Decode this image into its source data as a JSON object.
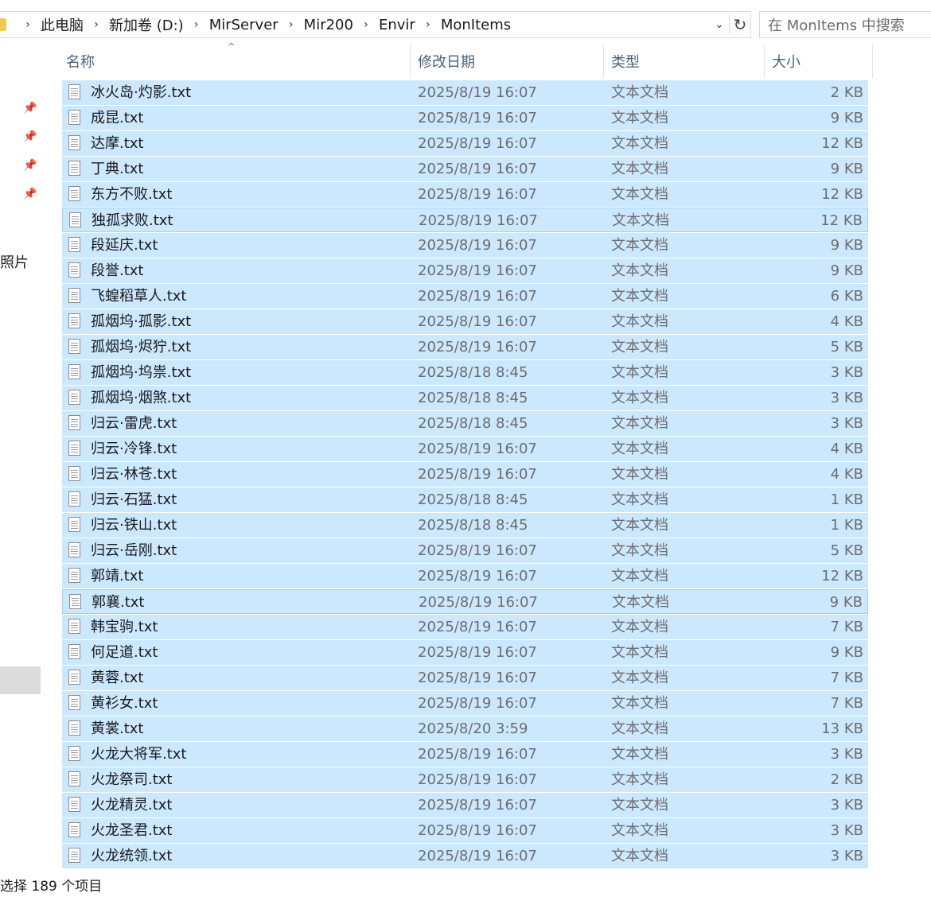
{
  "address": {
    "crumbs": [
      "此电脑",
      "新加卷 (D:)",
      "MirServer",
      "Mir200",
      "Envir",
      "MonItems"
    ],
    "separator": "›",
    "dropdown_glyph": "⌄",
    "refresh_glyph": "↻"
  },
  "search": {
    "placeholder": "在 MonItems 中搜索"
  },
  "nav": {
    "visible_label": "照片",
    "pin_icon": "pin-icon"
  },
  "columns": {
    "name": "名称",
    "date": "修改日期",
    "type": "类型",
    "size": "大小",
    "sort_glyph": "^"
  },
  "files": [
    {
      "name": "冰火岛·灼影.txt",
      "date": "2025/8/19 16:07",
      "type": "文本文档",
      "size": "2 KB"
    },
    {
      "name": "成昆.txt",
      "date": "2025/8/19 16:07",
      "type": "文本文档",
      "size": "9 KB"
    },
    {
      "name": "达摩.txt",
      "date": "2025/8/19 16:07",
      "type": "文本文档",
      "size": "12 KB"
    },
    {
      "name": "丁典.txt",
      "date": "2025/8/19 16:07",
      "type": "文本文档",
      "size": "9 KB"
    },
    {
      "name": "东方不败.txt",
      "date": "2025/8/19 16:07",
      "type": "文本文档",
      "size": "12 KB"
    },
    {
      "name": "独孤求败.txt",
      "date": "2025/8/19 16:07",
      "type": "文本文档",
      "size": "12 KB",
      "focused": true
    },
    {
      "name": "段延庆.txt",
      "date": "2025/8/19 16:07",
      "type": "文本文档",
      "size": "9 KB"
    },
    {
      "name": "段誉.txt",
      "date": "2025/8/19 16:07",
      "type": "文本文档",
      "size": "9 KB"
    },
    {
      "name": "飞蝗稻草人.txt",
      "date": "2025/8/19 16:07",
      "type": "文本文档",
      "size": "6 KB"
    },
    {
      "name": "孤烟坞·孤影.txt",
      "date": "2025/8/19 16:07",
      "type": "文本文档",
      "size": "4 KB"
    },
    {
      "name": "孤烟坞·烬狞.txt",
      "date": "2025/8/19 16:07",
      "type": "文本文档",
      "size": "5 KB"
    },
    {
      "name": "孤烟坞·坞祟.txt",
      "date": "2025/8/18 8:45",
      "type": "文本文档",
      "size": "3 KB"
    },
    {
      "name": "孤烟坞·烟煞.txt",
      "date": "2025/8/18 8:45",
      "type": "文本文档",
      "size": "3 KB"
    },
    {
      "name": "归云·雷虎.txt",
      "date": "2025/8/18 8:45",
      "type": "文本文档",
      "size": "3 KB"
    },
    {
      "name": "归云·冷锋.txt",
      "date": "2025/8/19 16:07",
      "type": "文本文档",
      "size": "4 KB"
    },
    {
      "name": "归云·林苍.txt",
      "date": "2025/8/19 16:07",
      "type": "文本文档",
      "size": "4 KB"
    },
    {
      "name": "归云·石猛.txt",
      "date": "2025/8/18 8:45",
      "type": "文本文档",
      "size": "1 KB"
    },
    {
      "name": "归云·铁山.txt",
      "date": "2025/8/18 8:45",
      "type": "文本文档",
      "size": "1 KB"
    },
    {
      "name": "归云·岳刚.txt",
      "date": "2025/8/19 16:07",
      "type": "文本文档",
      "size": "5 KB"
    },
    {
      "name": "郭靖.txt",
      "date": "2025/8/19 16:07",
      "type": "文本文档",
      "size": "12 KB"
    },
    {
      "name": "郭襄.txt",
      "date": "2025/8/19 16:07",
      "type": "文本文档",
      "size": "9 KB",
      "focused": true
    },
    {
      "name": "韩宝驹.txt",
      "date": "2025/8/19 16:07",
      "type": "文本文档",
      "size": "7 KB"
    },
    {
      "name": "何足道.txt",
      "date": "2025/8/19 16:07",
      "type": "文本文档",
      "size": "9 KB"
    },
    {
      "name": "黄蓉.txt",
      "date": "2025/8/19 16:07",
      "type": "文本文档",
      "size": "7 KB"
    },
    {
      "name": "黄衫女.txt",
      "date": "2025/8/19 16:07",
      "type": "文本文档",
      "size": "7 KB"
    },
    {
      "name": "黄裳.txt",
      "date": "2025/8/20 3:59",
      "type": "文本文档",
      "size": "13 KB"
    },
    {
      "name": "火龙大将军.txt",
      "date": "2025/8/19 16:07",
      "type": "文本文档",
      "size": "3 KB"
    },
    {
      "name": "火龙祭司.txt",
      "date": "2025/8/19 16:07",
      "type": "文本文档",
      "size": "2 KB"
    },
    {
      "name": "火龙精灵.txt",
      "date": "2025/8/19 16:07",
      "type": "文本文档",
      "size": "3 KB"
    },
    {
      "name": "火龙圣君.txt",
      "date": "2025/8/19 16:07",
      "type": "文本文档",
      "size": "3 KB"
    },
    {
      "name": "火龙统领.txt",
      "date": "2025/8/19 16:07",
      "type": "文本文档",
      "size": "3 KB"
    }
  ],
  "file_icon": "text-file-icon",
  "status": {
    "text": "选择 189 个项目"
  },
  "colors": {
    "selection": "#cce8ff",
    "focus_border": "#99d1ff",
    "header_text": "#4c607a"
  }
}
